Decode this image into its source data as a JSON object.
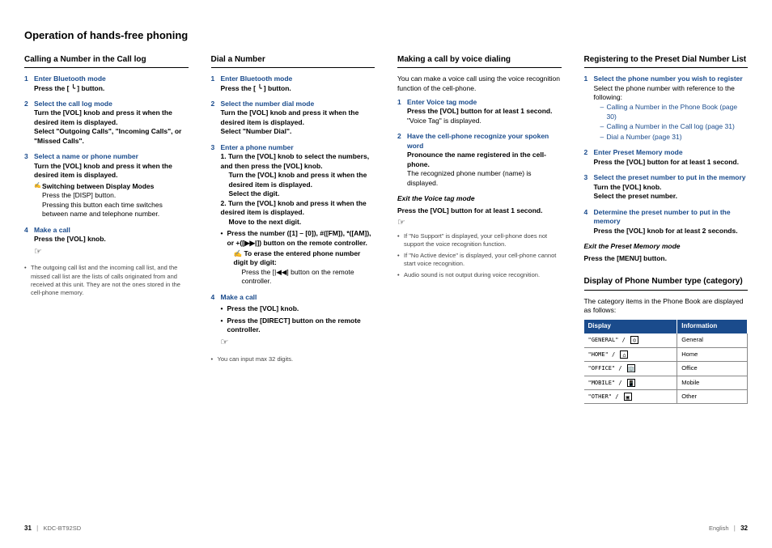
{
  "title": "Operation of hands-free phoning",
  "col1": {
    "head": "Calling a Number in the Call log",
    "s1t": "Enter Bluetooth mode",
    "s1b": "Press the [ ╰ ] button.",
    "s2t": "Select the call log mode",
    "s2b": "Turn the [VOL] knob and press it when the desired item is displayed.",
    "s2c": "Select \"Outgoing Calls\", \"Incoming Calls\", or \"Missed Calls\".",
    "s3t": "Select a name or phone number",
    "s3b": "Turn the [VOL] knob and press it when the desired item is displayed.",
    "s3nt": "Switching between Display Modes",
    "s3nb": "Press the [DISP] button.",
    "s3nc": "Pressing this button each time switches between name and telephone number.",
    "s4t": "Make a call",
    "s4b": "Press the [VOL] knob.",
    "note1": "The outgoing call list and the incoming call list, and the missed call list are the lists of calls originated from and received at this unit. They are not the ones stored in the cell-phone memory."
  },
  "col2": {
    "head": "Dial a Number",
    "s1t": "Enter Bluetooth mode",
    "s1b": "Press the [ ╰ ] button.",
    "s2t": "Select the number dial mode",
    "s2b": "Turn the [VOL] knob and press it when the desired item is displayed.",
    "s2c": "Select \"Number Dial\".",
    "s3t": "Enter a phone number",
    "s3a": "1. Turn the [VOL] knob to select the numbers, and then press the [VOL] knob.",
    "s3a2": "Turn the [VOL] knob and press it when the desired item is displayed.",
    "s3a3": "Select the digit.",
    "s3b": "2. Turn the [VOL] knob and press it when the desired item is displayed.",
    "s3b2": "Move to the next digit.",
    "s3bul1": "Press the number ([1] – [0]), #([FM]), *([AM]), or +([▶▶|]) button on the remote controller.",
    "s3nt": "To erase the entered phone number digit by digit:",
    "s3nb": "Press the [|◀◀] button on the remote controller.",
    "s4t": "Make a call",
    "s4bul1": "Press the [VOL] knob.",
    "s4bul2": "Press the [DIRECT] button on the remote controller.",
    "note1": "You can input max 32 digits."
  },
  "col3": {
    "head": "Making a call by voice dialing",
    "intro": "You can make a voice call using the voice recognition function of the cell-phone.",
    "s1t": "Enter Voice tag mode",
    "s1b": "Press the [VOL] button for at least 1 second.",
    "s1c": "\"Voice Tag\" is displayed.",
    "s2t": "Have the cell-phone recognize your spoken word",
    "s2b": "Pronounce the name registered in the cell-phone.",
    "s2c": "The recognized phone number (name) is displayed.",
    "exith": "Exit the Voice tag mode",
    "exitb": "Press the [VOL] button for at least 1 second.",
    "note1": "If \"No Support\" is displayed, your cell-phone does not support the voice recognition function.",
    "note2": "If \"No Active device\" is displayed, your cell-phone cannot start voice recognition.",
    "note3": "Audio sound is not output during voice recognition."
  },
  "col4a": {
    "head": "Registering to the Preset Dial Number List",
    "s1t": "Select the phone number you wish to register",
    "s1b": "Select the phone number with reference to the following:",
    "l1": "Calling a Number in the Phone Book (page 30)",
    "l2": "Calling a Number in the Call log (page 31)",
    "l3": "Dial a Number (page 31)",
    "s2t": "Enter Preset Memory mode",
    "s2b": "Press the [VOL] button for at least 1 second.",
    "s3t": "Select the preset number to put in the memory",
    "s3b": "Turn the [VOL] knob.",
    "s3c": "Select the preset number.",
    "s4t": "Determine the preset number to put in the memory",
    "s4b": "Press the [VOL] knob for at least 2 seconds.",
    "exith": "Exit the Preset Memory mode",
    "exitb": "Press the [MENU] button."
  },
  "col4b": {
    "head": "Display of Phone Number type (category)",
    "intro": "The category items in the Phone Book are displayed as follows:",
    "thd": "Display",
    "thi": "Information",
    "r1d": "\"GENERAL\" /",
    "r1i": "General",
    "r2d": "\"HOME\" /",
    "r2i": "Home",
    "r3d": "\"OFFICE\" /",
    "r3i": "Office",
    "r4d": "\"MOBILE\" /",
    "r4i": "Mobile",
    "r5d": "\"OTHER\" /",
    "r5i": "Other"
  },
  "footer": {
    "leftPage": "31",
    "model": "KDC-BT92SD",
    "lang": "English",
    "rightPage": "32"
  }
}
